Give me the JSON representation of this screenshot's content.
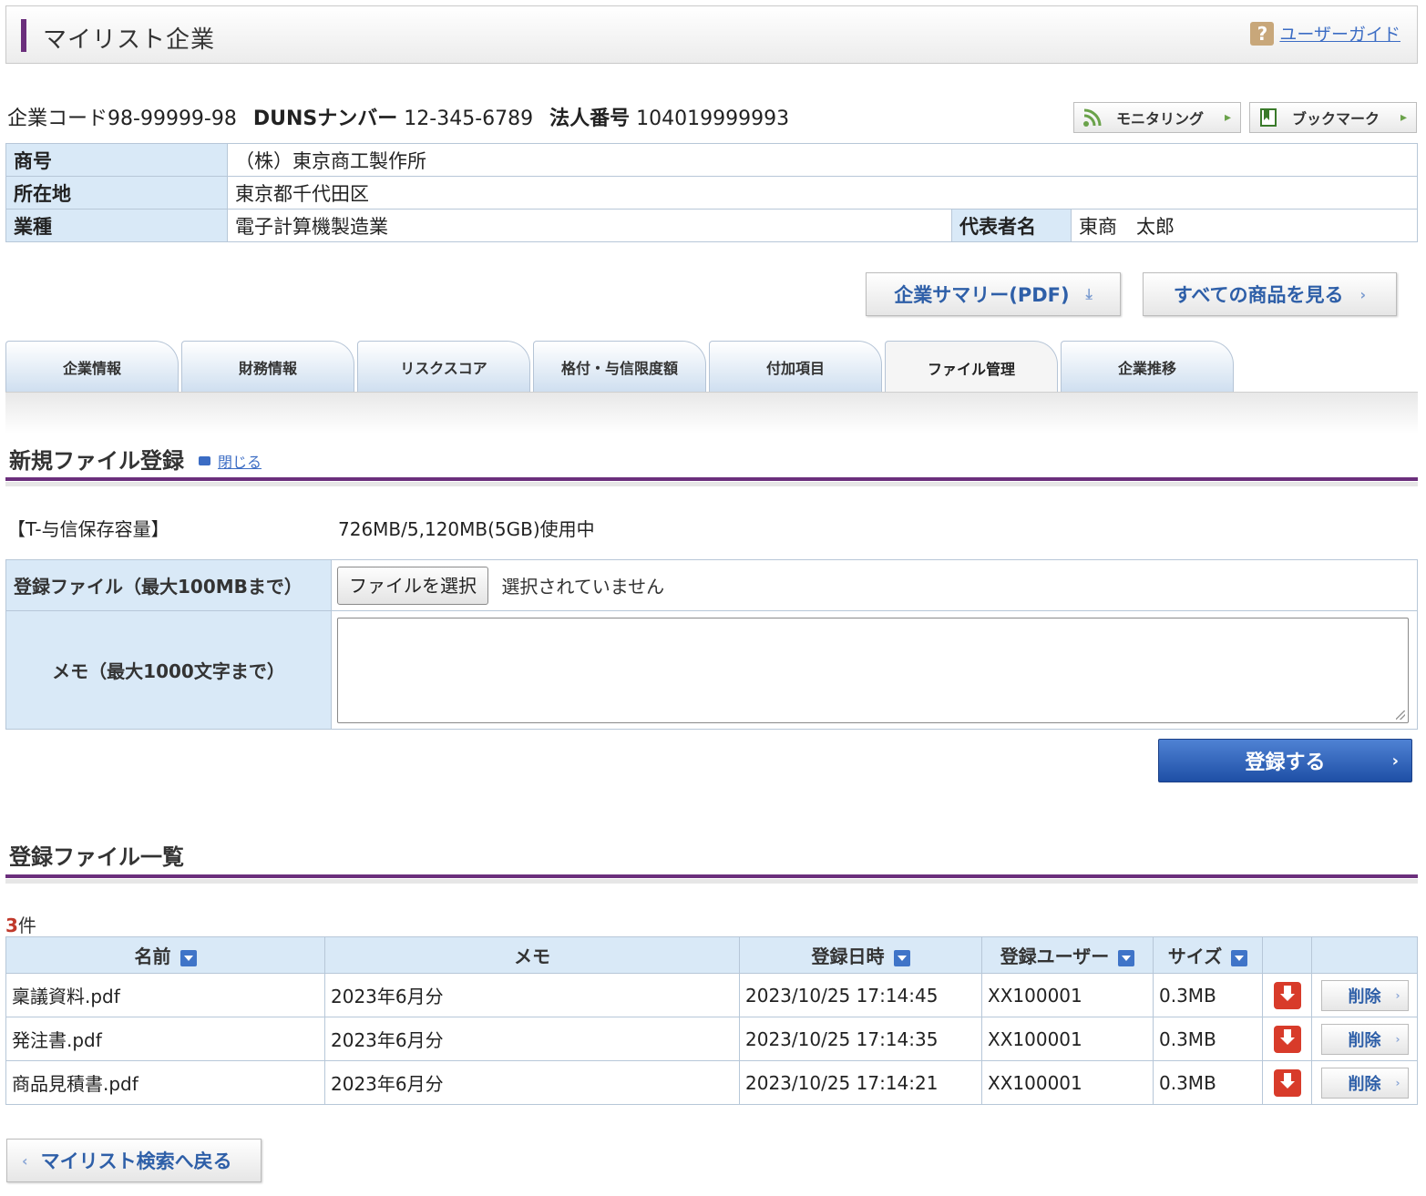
{
  "header": {
    "title": "マイリスト企業",
    "guide_link": "ユーザーガイド"
  },
  "codes": {
    "company_code_label": "企業コード",
    "company_code": "98-99999-98",
    "duns_label": "DUNSナンバー",
    "duns": "12-345-6789",
    "corp_label": "法人番号",
    "corp_number": "104019999993"
  },
  "actions": {
    "monitoring": "モニタリング",
    "bookmark": "ブックマーク"
  },
  "info": {
    "name_label": "商号",
    "name": "（株）東京商工製作所",
    "address_label": "所在地",
    "address": "東京都千代田区",
    "industry_label": "業種",
    "industry": "電子計算機製造業",
    "rep_label": "代表者名",
    "rep": "東商　太郎"
  },
  "buttons": {
    "summary_pdf": "企業サマリー(PDF)",
    "all_products": "すべての商品を見る",
    "submit": "登録する",
    "back": "マイリスト検索へ戻る"
  },
  "tabs": [
    {
      "label": "企業情報"
    },
    {
      "label": "財務情報"
    },
    {
      "label": "リスクスコア"
    },
    {
      "label": "格付・与信限度額"
    },
    {
      "label": "付加項目"
    },
    {
      "label": "ファイル管理"
    },
    {
      "label": "企業推移"
    }
  ],
  "new_file": {
    "title": "新規ファイル登録",
    "close": "閉じる",
    "storage_label": "【T-与信保存容量】",
    "storage_value": "726MB/5,120MB(5GB)使用中",
    "file_label": "登録ファイル（最大100MBまで）",
    "file_button": "ファイルを選択",
    "file_status": "選択されていません",
    "memo_label": "メモ（最大1000文字まで）"
  },
  "file_list": {
    "title": "登録ファイル一覧",
    "count": "3",
    "count_unit": "件",
    "columns": {
      "name": "名前",
      "memo": "メモ",
      "date": "登録日時",
      "user": "登録ユーザー",
      "size": "サイズ"
    },
    "delete_label": "削除",
    "rows": [
      {
        "name": "稟議資料.pdf",
        "memo": "2023年6月分",
        "date": "2023/10/25 17:14:45",
        "user": "XX100001",
        "size": "0.3MB"
      },
      {
        "name": "発注書.pdf",
        "memo": "2023年6月分",
        "date": "2023/10/25 17:14:35",
        "user": "XX100001",
        "size": "0.3MB"
      },
      {
        "name": "商品見積書.pdf",
        "memo": "2023年6月分",
        "date": "2023/10/25 17:14:21",
        "user": "XX100001",
        "size": "0.3MB"
      }
    ]
  }
}
